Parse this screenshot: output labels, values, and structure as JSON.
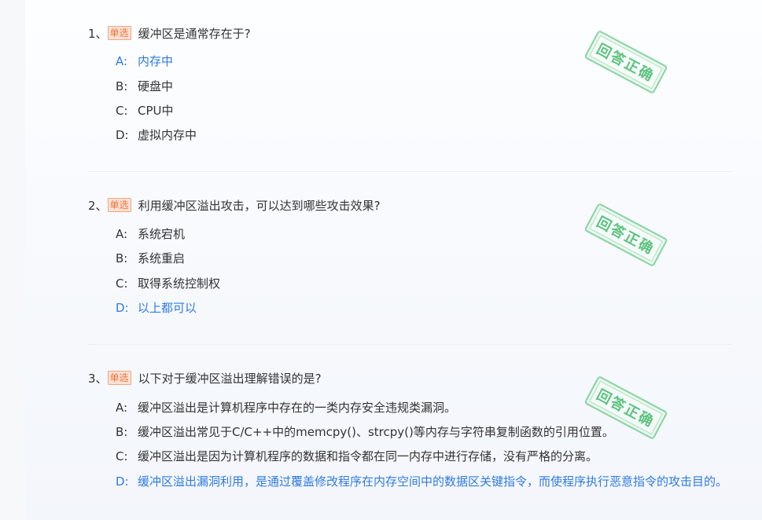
{
  "questions": [
    {
      "number": "1、",
      "tag": "单选",
      "text": "缓冲区是通常存在于?",
      "stamp": "回答正确",
      "options": [
        {
          "letter": "A:",
          "text": "内存中",
          "correct": true
        },
        {
          "letter": "B:",
          "text": "硬盘中",
          "correct": false
        },
        {
          "letter": "C:",
          "text": "CPU中",
          "correct": false
        },
        {
          "letter": "D:",
          "text": "虚拟内存中",
          "correct": false
        }
      ]
    },
    {
      "number": "2、",
      "tag": "单选",
      "text": "利用缓冲区溢出攻击，可以达到哪些攻击效果?",
      "stamp": "回答正确",
      "options": [
        {
          "letter": "A:",
          "text": "系统宕机",
          "correct": false
        },
        {
          "letter": "B:",
          "text": "系统重启",
          "correct": false
        },
        {
          "letter": "C:",
          "text": "取得系统控制权",
          "correct": false
        },
        {
          "letter": "D:",
          "text": "以上都可以",
          "correct": true
        }
      ]
    },
    {
      "number": "3、",
      "tag": "单选",
      "text": "以下对于缓冲区溢出理解错误的是?",
      "stamp": "回答正确",
      "options": [
        {
          "letter": "A:",
          "text": "缓冲区溢出是计算机程序中存在的一类内存安全违规类漏洞。",
          "correct": false
        },
        {
          "letter": "B:",
          "text": "缓冲区溢出常见于C/C++中的memcpy()、strcpy()等内存与字符串复制函数的引用位置。",
          "correct": false
        },
        {
          "letter": "C:",
          "text": "缓冲区溢出是因为计算机程序的数据和指令都在同一内存中进行存储，没有严格的分离。",
          "correct": false
        },
        {
          "letter": "D:",
          "text": "缓冲区溢出漏洞利用，是通过覆盖修改程序在内存空间中的数据区关键指令，而使程序执行恶意指令的攻击目的。",
          "correct": true
        }
      ]
    }
  ]
}
